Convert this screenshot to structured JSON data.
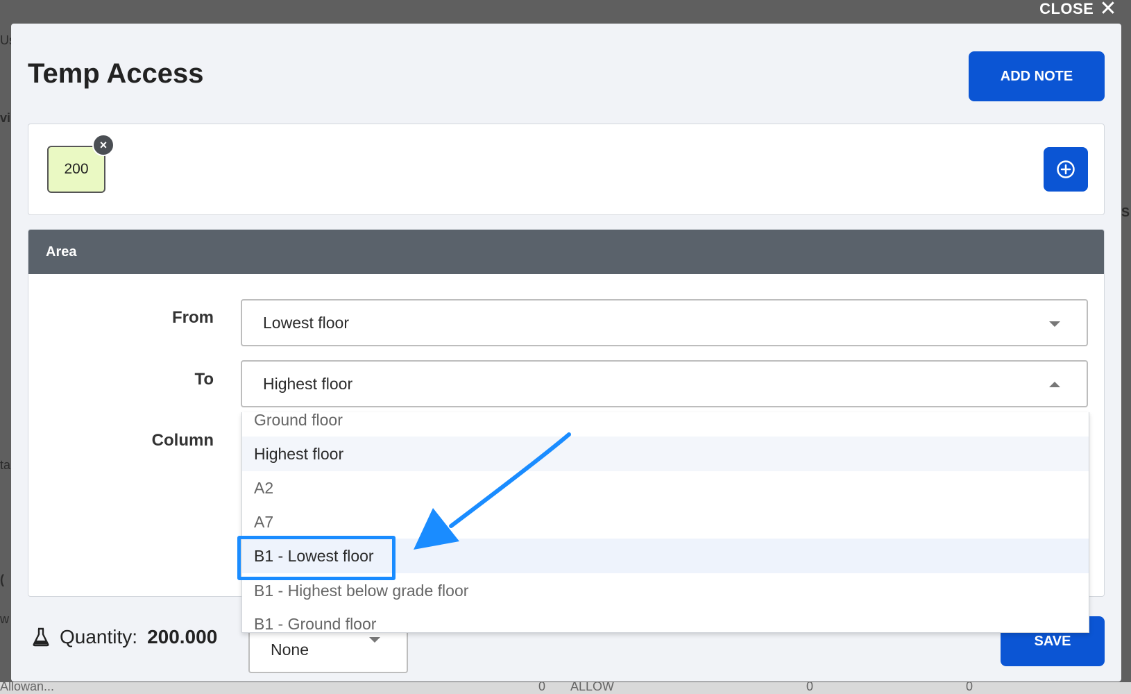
{
  "background": {
    "left_fragments": [
      "Us",
      "vi",
      "ta",
      "(",
      "w",
      "Allowan..."
    ],
    "right_fragments": [
      "S"
    ],
    "bottom_fragments": [
      "Allowan...",
      "0",
      "ALLOW",
      "0",
      "0"
    ]
  },
  "close": {
    "label": "CLOSE"
  },
  "modal": {
    "title": "Temp Access",
    "add_note_label": "ADD NOTE",
    "chip": {
      "value": "200",
      "remove_symbol": "×"
    },
    "area": {
      "header": "Area",
      "from_label": "From",
      "from_value": "Lowest floor",
      "to_label": "To",
      "to_value": "Highest floor",
      "column_label": "Column"
    },
    "dropdown": {
      "options": [
        "Ground floor",
        "Highest floor",
        "A2",
        "A7",
        "B1 - Lowest floor",
        "B1 - Highest below grade floor",
        "B1 - Ground floor"
      ],
      "selected_index": 1,
      "highlighted_index": 4
    },
    "footer": {
      "quantity_label": "Quantity:",
      "quantity_value": "200.000",
      "column_select_value": "None",
      "save_label": "SAVE"
    }
  },
  "colors": {
    "primary": "#0b55d4",
    "area_header": "#5a626b",
    "chip_background": "#eaf9c3",
    "annotation": "#1a8cff"
  },
  "icons": {
    "close": "close-x-icon",
    "add": "plus-circle-icon",
    "quantity": "flask-icon",
    "dropdown": "caret-down-icon"
  }
}
